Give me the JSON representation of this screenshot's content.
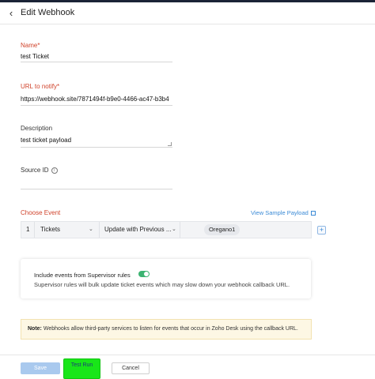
{
  "header": {
    "title": "Edit Webhook",
    "back_icon": "chevron-left-icon"
  },
  "form": {
    "name": {
      "label": "Name",
      "value": "test Ticket"
    },
    "url": {
      "label": "URL to notify",
      "value": "https://webhook.site/7871494f-b9e0-4466-ac47-b3b4"
    },
    "description": {
      "label": "Description",
      "value": "test ticket payload"
    },
    "source_id": {
      "label": "Source ID",
      "value": ""
    },
    "required_mark": "*"
  },
  "events": {
    "label": "Choose Event",
    "view_sample": "View Sample Payload",
    "rows": [
      {
        "index": "1",
        "module": "Tickets",
        "event": "Update with Previous ...",
        "department": "Oregano1"
      }
    ]
  },
  "supervisor": {
    "title": "Include events from Supervisor rules",
    "description": "Supervisor rules will bulk update ticket events which may slow down your webhook callback URL.",
    "enabled": true
  },
  "note": {
    "prefix": "Note:",
    "text": "Webhooks allow third-party services to listen for events that occur in Zoho Desk using the callback URL."
  },
  "footer": {
    "save": "Save",
    "test_run": "Test Run",
    "cancel": "Cancel"
  },
  "colors": {
    "required": "#d0432b",
    "link": "#3a8ad6",
    "save_button": "#a9c9ee",
    "toggle_on": "#3cb371",
    "highlight": "#19e619",
    "note_bg": "#fdf7e4"
  }
}
